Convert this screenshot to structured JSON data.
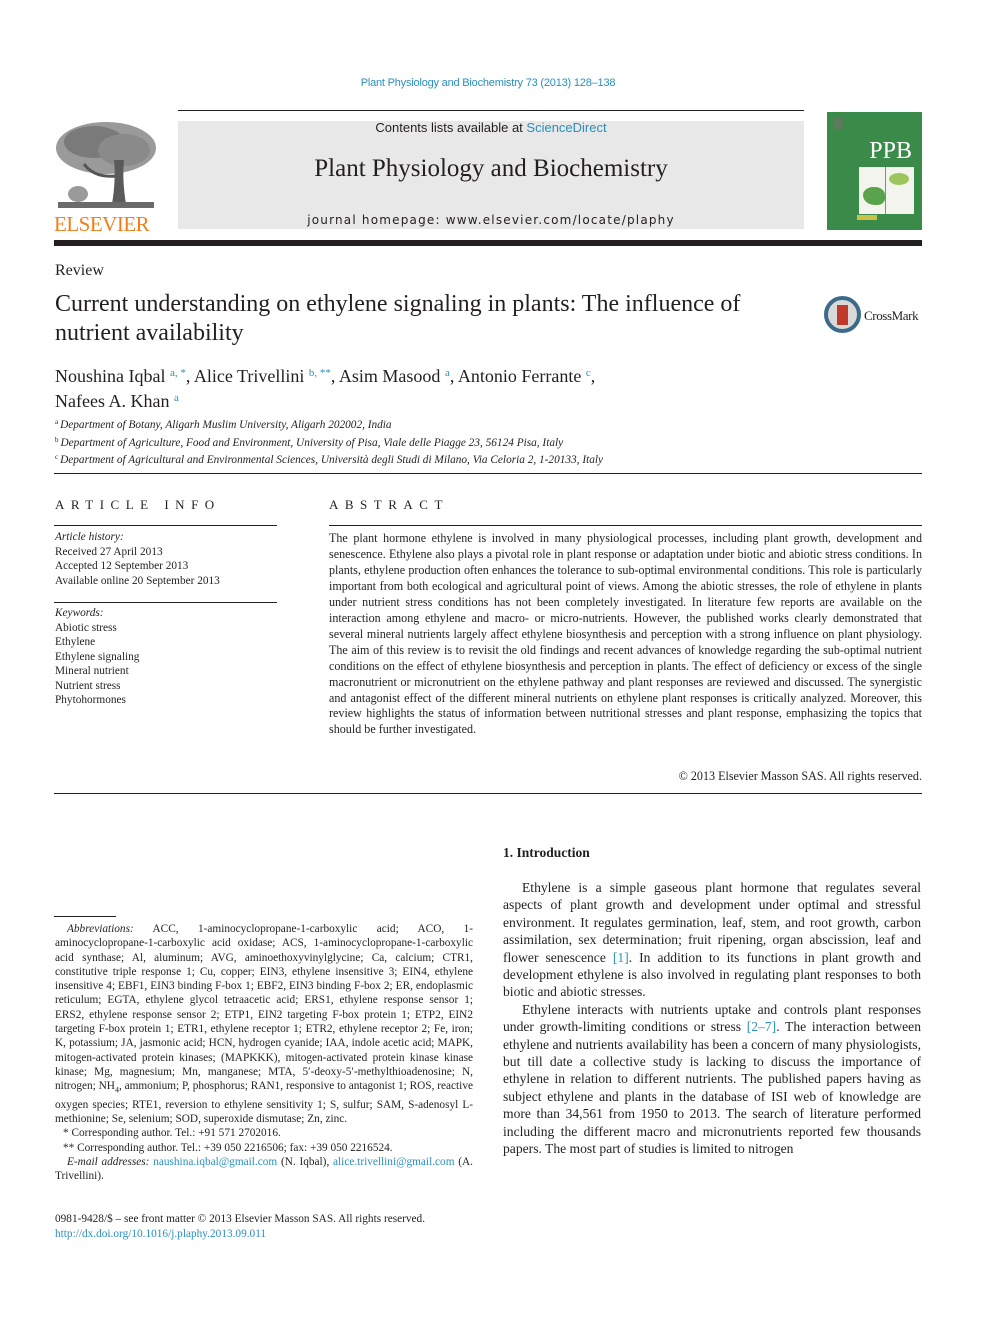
{
  "running_head": "Plant Physiology and Biochemistry 73 (2013) 128–138",
  "masthead": {
    "contents_prefix": "Contents lists available at ",
    "contents_link": "ScienceDirect",
    "journal_title": "Plant Physiology and Biochemistry",
    "homepage": "journal homepage: www.elsevier.com/locate/plaphy",
    "publisher_logo_text": "ELSEVIER",
    "cover_abbrev": "PPB",
    "colors": {
      "elsevier_orange": "#f07f1a",
      "cover_green": "#3a8a4a",
      "link_blue": "#2a8fbd"
    }
  },
  "article": {
    "type": "Review",
    "title": "Current understanding on ethylene signaling in plants: The influence of nutrient availability",
    "crossmark_label": "CrossMark",
    "authors": [
      {
        "name": "Noushina Iqbal",
        "sup": "a, *",
        "sep": ", "
      },
      {
        "name": "Alice Trivellini",
        "sup": "b, **",
        "sep": ", "
      },
      {
        "name": "Asim Masood",
        "sup": "a",
        "sep": ", "
      },
      {
        "name": "Antonio Ferrante",
        "sup": "c",
        "sep": ","
      },
      {
        "name": "Nafees A. Khan",
        "sup": "a",
        "sep": ""
      }
    ],
    "affiliations": [
      {
        "key": "a",
        "text": "Department of Botany, Aligarh Muslim University, Aligarh 202002, India"
      },
      {
        "key": "b",
        "text": "Department of Agriculture, Food and Environment, University of Pisa, Viale delle Piagge 23, 56124 Pisa, Italy"
      },
      {
        "key": "c",
        "text": "Department of Agricultural and Environmental Sciences, Università degli Studi di Milano, Via Celoria 2, 1-20133, Italy"
      }
    ]
  },
  "article_info": {
    "heading": "ARTICLE INFO",
    "history_label": "Article history:",
    "history": [
      "Received 27 April 2013",
      "Accepted 12 September 2013",
      "Available online 20 September 2013"
    ],
    "keywords_label": "Keywords:",
    "keywords": [
      "Abiotic stress",
      "Ethylene",
      "Ethylene signaling",
      "Mineral nutrient",
      "Nutrient stress",
      "Phytohormones"
    ]
  },
  "abstract": {
    "heading": "ABSTRACT",
    "text": "The plant hormone ethylene is involved in many physiological processes, including plant growth, development and senescence. Ethylene also plays a pivotal role in plant response or adaptation under biotic and abiotic stress conditions. In plants, ethylene production often enhances the tolerance to sub-optimal environmental conditions. This role is particularly important from both ecological and agricultural point of views. Among the abiotic stresses, the role of ethylene in plants under nutrient stress conditions has not been completely investigated. In literature few reports are available on the interaction among ethylene and macro- or micro-nutrients. However, the published works clearly demonstrated that several mineral nutrients largely affect ethylene biosynthesis and perception with a strong influence on plant physiology. The aim of this review is to revisit the old findings and recent advances of knowledge regarding the sub-optimal nutrient conditions on the effect of ethylene biosynthesis and perception in plants. The effect of deficiency or excess of the single macronutrient or micronutrient on the ethylene pathway and plant responses are reviewed and discussed. The synergistic and antagonist effect of the different mineral nutrients on ethylene plant responses is critically analyzed. Moreover, this review highlights the status of information between nutritional stresses and plant response, emphasizing the topics that should be further investigated.",
    "copyright": "© 2013 Elsevier Masson SAS. All rights reserved."
  },
  "footnotes": {
    "abbrev_label": "Abbreviations:",
    "abbrev_text_1": " ACC, 1-aminocyclopropane-1-carboxylic acid; ACO, 1-aminocyclopropane-1-carboxylic acid oxidase; ACS, 1-aminocyclopropane-1-carboxylic acid synthase; Al, aluminum; AVG, aminoethoxyvinylglycine; Ca, calcium; CTR1, constitutive triple response 1; Cu, copper; EIN3, ethylene insensitive 3; EIN4, ethylene insensitive 4; EBF1, EIN3 binding F-box 1; EBF2, EIN3 binding F-box 2; ER, endoplasmic reticulum; EGTA, ethylene glycol tetraacetic acid; ERS1, ethylene response sensor 1; ERS2, ethylene response sensor 2; ETP1, EIN2 targeting F-box protein 1; ETP2, EIN2 targeting F-box protein 1; ETR1, ethylene receptor 1; ETR2, ethylene receptor 2; Fe, iron; K, potassium; JA, jasmonic acid; HCN, hydrogen cyanide; IAA, indole acetic acid; MAPK, mitogen-activated protein kinases; (MAPKKK), mitogen-activated protein kinase kinase kinase; Mg, magnesium; Mn, manganese; MTA, 5′-deoxy-5′-methylthioadenosine; N, nitrogen; NH",
    "abbrev_sub": "4",
    "abbrev_text_2": ", ammonium; P, phosphorus; RAN1, responsive to antagonist 1; ROS, reactive oxygen species; RTE1, reversion to ethylene sensitivity 1; S, sulfur; SAM, S-adenosyl L-methionine; Se, selenium; SOD, superoxide dismutase; Zn, zinc.",
    "corr1": "* Corresponding author. Tel.: +91 571 2702016.",
    "corr2": "** Corresponding author. Tel.: +39 050 2216506; fax: +39 050 2216524.",
    "email_label": "E-mail addresses:",
    "email1": "naushina.iqbal@gmail.com",
    "email1_name": " (N. Iqbal), ",
    "email2": "alice.trivellini@gmail.com",
    "email2_name": " (A. Trivellini)."
  },
  "front_matter": {
    "issn_line": "0981-9428/$ – see front matter © 2013 Elsevier Masson SAS. All rights reserved.",
    "doi": "http://dx.doi.org/10.1016/j.plaphy.2013.09.011"
  },
  "introduction": {
    "heading": "1.  Introduction",
    "p1_a": "Ethylene is a simple gaseous plant hormone that regulates several aspects of plant growth and development under optimal and stressful environment. It regulates germination, leaf, stem, and root growth, carbon assimilation, sex determination; fruit ripening, organ abscission, leaf and flower senescence ",
    "p1_ref": "[1]",
    "p1_b": ". In addition to its functions in plant growth and development ethylene is also involved in regulating plant responses to both biotic and abiotic stresses.",
    "p2_a": "Ethylene interacts with nutrients uptake and controls plant responses under growth-limiting conditions or stress ",
    "p2_ref": "[2–7]",
    "p2_b": ". The interaction between ethylene and nutrients availability has been a concern of many physiologists, but till date a collective study is lacking to discuss the importance of ethylene in relation to different nutrients. The published papers having as subject ethylene and plants in the database of ISI web of knowledge are more than 34,561 from 1950 to 2013. The search of literature performed including the different macro and micronutrients reported few thousands papers. The most part of studies is limited to nitrogen"
  }
}
